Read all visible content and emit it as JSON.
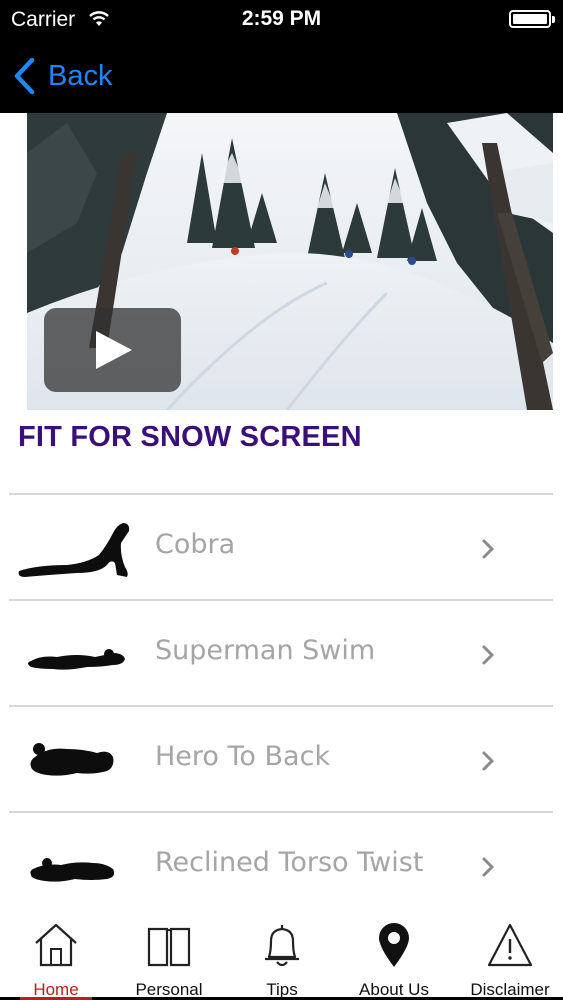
{
  "status_bar": {
    "carrier": "Carrier",
    "time": "2:59 PM",
    "wifi_icon": "wifi-icon",
    "battery_icon": "battery-icon"
  },
  "nav": {
    "back_label": "Back",
    "back_icon": "chevron-left-icon",
    "accent_color": "#1e86ff"
  },
  "video": {
    "thumbnail": "snowy-forest-skiers",
    "play_icon": "play-icon"
  },
  "page_title": "FIT FOR SNOW SCREEN",
  "exercises": [
    {
      "label": "Cobra",
      "thumb_icon": "cobra-pose-silhouette-icon"
    },
    {
      "label": "Superman Swim",
      "thumb_icon": "superman-swim-silhouette-icon"
    },
    {
      "label": "Hero To Back",
      "thumb_icon": "hero-to-back-silhouette-icon"
    },
    {
      "label": "Reclined Torso Twist",
      "thumb_icon": "reclined-torso-twist-silhouette-icon"
    }
  ],
  "tabs": [
    {
      "label": "Home",
      "icon": "home-icon",
      "active": true
    },
    {
      "label": "Personal",
      "icon": "book-icon",
      "active": false
    },
    {
      "label": "Tips",
      "icon": "bell-icon",
      "active": false
    },
    {
      "label": "About Us",
      "icon": "location-pin-icon",
      "active": false
    },
    {
      "label": "Disclaimer",
      "icon": "warning-icon",
      "active": false
    }
  ],
  "colors": {
    "title": "#3a0f7a",
    "active_tab": "#b81f1f",
    "list_text": "#a5a5a5"
  }
}
